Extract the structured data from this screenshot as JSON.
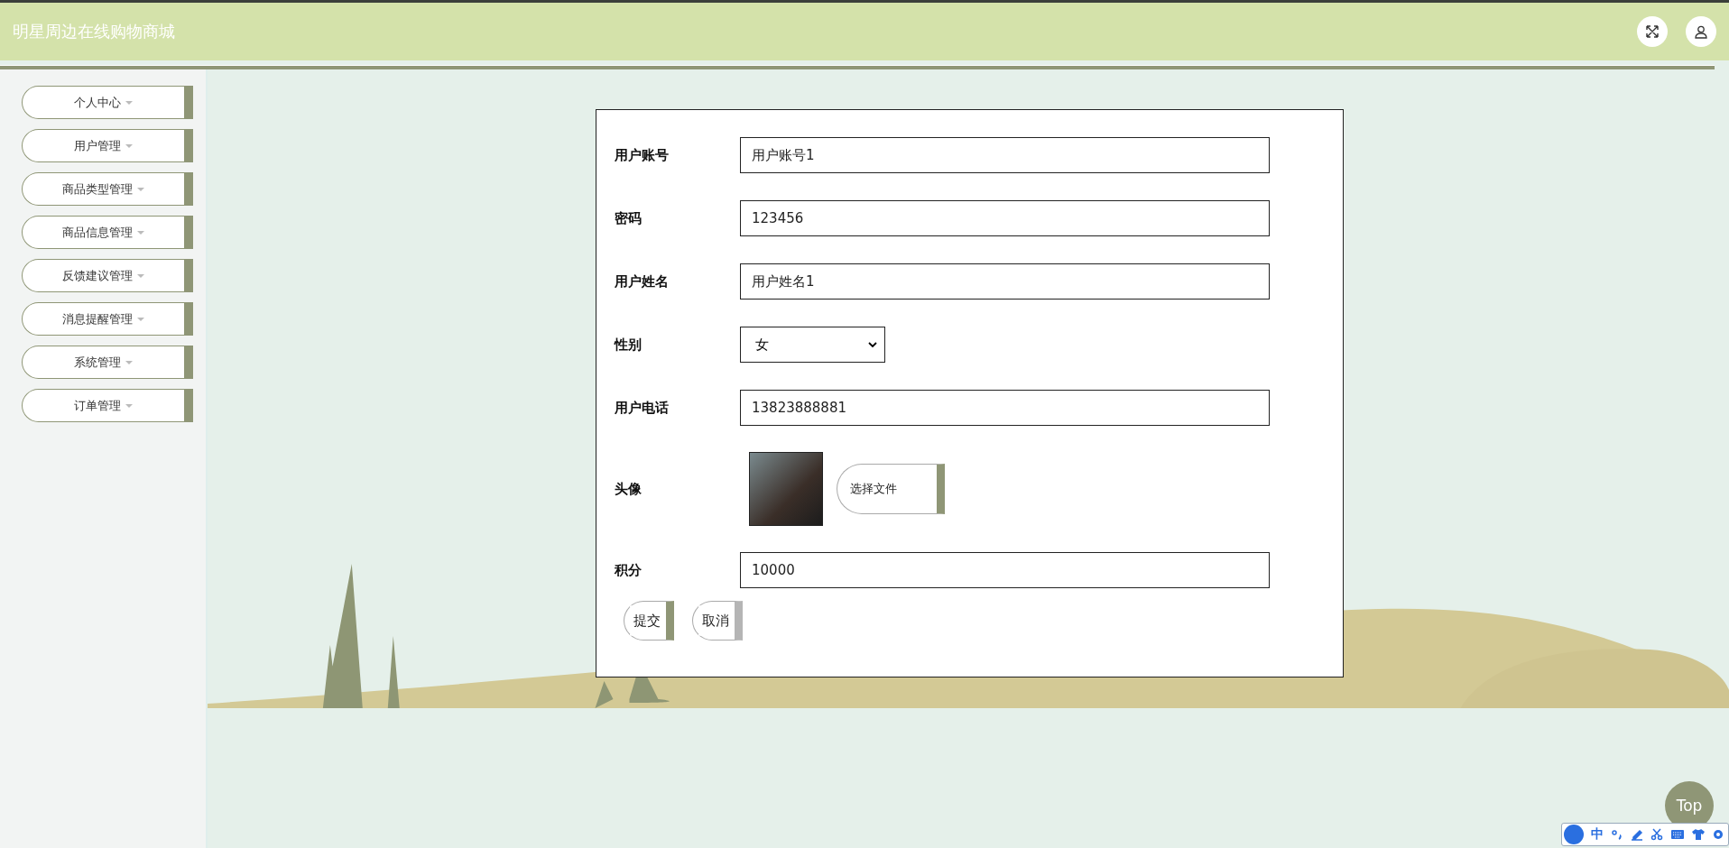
{
  "header": {
    "title": "明星周边在线购物商城"
  },
  "sidebar": {
    "items": [
      {
        "label": "个人中心"
      },
      {
        "label": "用户管理"
      },
      {
        "label": "商品类型管理"
      },
      {
        "label": "商品信息管理"
      },
      {
        "label": "反馈建议管理"
      },
      {
        "label": "消息提醒管理"
      },
      {
        "label": "系统管理"
      },
      {
        "label": "订单管理"
      }
    ]
  },
  "form": {
    "fields": [
      {
        "kind": "text",
        "label": "用户账号",
        "value": "用户账号1"
      },
      {
        "kind": "text",
        "label": "密码",
        "value": "123456"
      },
      {
        "kind": "text",
        "label": "用户姓名",
        "value": "用户姓名1"
      },
      {
        "kind": "select",
        "label": "性别",
        "value": "女"
      },
      {
        "kind": "text",
        "label": "用户电话",
        "value": "13823888881"
      },
      {
        "kind": "image",
        "label": "头像",
        "button": "选择文件"
      },
      {
        "kind": "text",
        "label": "积分",
        "value": "10000"
      }
    ],
    "buttons": [
      "提交",
      "取消"
    ]
  },
  "top_button": "Top",
  "ime_toolbar": {
    "mode": "中"
  }
}
